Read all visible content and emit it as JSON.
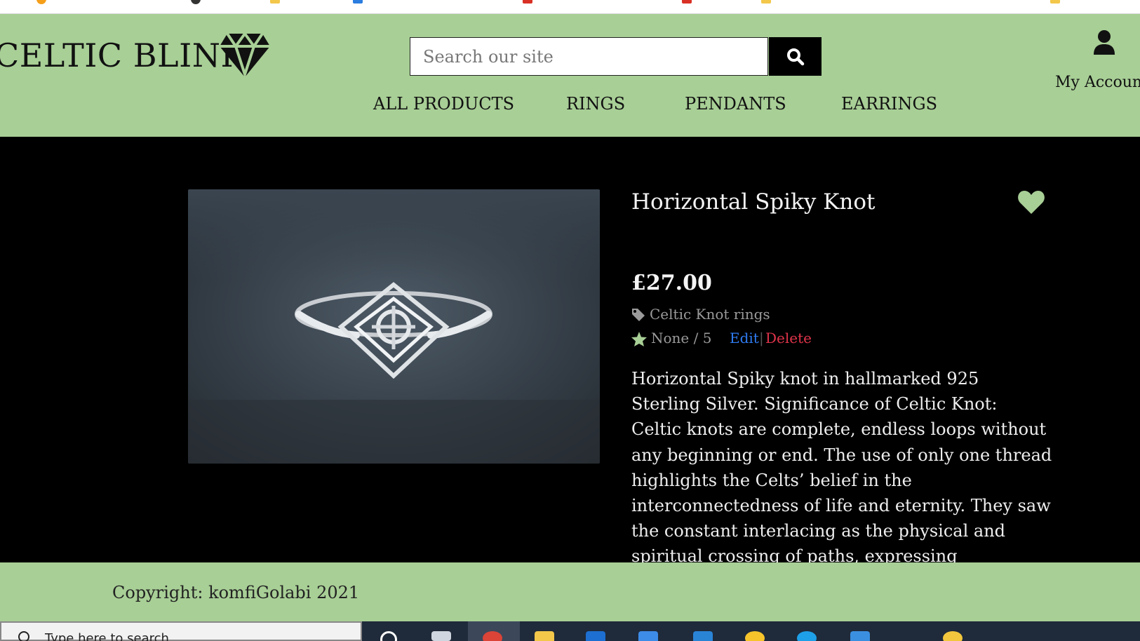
{
  "header": {
    "logo": "CELTIC BLINK",
    "search": {
      "placeholder": "Search our site"
    },
    "account_label": "My Account",
    "nav": [
      "ALL PRODUCTS",
      "RINGS",
      "PENDANTS",
      "EARRINGS"
    ]
  },
  "product": {
    "title": "Horizontal Spiky Knot",
    "price": "£27.00",
    "category": "Celtic Knot rings",
    "rating": "None / 5",
    "edit_label": "Edit",
    "separator": "|",
    "delete_label": "Delete",
    "description": "Horizontal Spiky knot in hallmarked 925 Sterling Silver. Significance of Celtic Knot: Celtic knots are complete, endless loops without any beginning or end. The use of only one thread highlights the Celts’ belief in the interconnectedness of life and eternity. They saw the constant interlacing as the physical and spiritual crossing of paths, expressing permanence and the endurance of life, love and"
  },
  "footer": {
    "copyright": "Copyright: komfiGolabi 2021"
  },
  "taskbar": {
    "search_text": "Type here to search"
  },
  "colors": {
    "header_bg": "#a8cf96",
    "page_bg": "#000000",
    "accent_green": "#a8cf96",
    "edit_link": "#2f7cf3",
    "delete_link": "#e0344a"
  },
  "icons": [
    "diamond-logo-icon",
    "search-icon",
    "user-icon",
    "heart-icon",
    "tag-icon",
    "star-icon"
  ]
}
